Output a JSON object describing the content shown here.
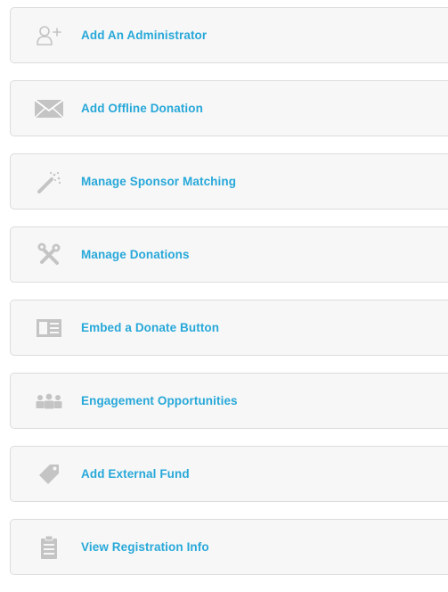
{
  "actions": [
    {
      "label": "Add An Administrator",
      "icon": "add-user-icon"
    },
    {
      "label": "Add Offline Donation",
      "icon": "envelope-icon"
    },
    {
      "label": "Manage Sponsor Matching",
      "icon": "magic-wand-icon"
    },
    {
      "label": "Manage Donations",
      "icon": "tools-icon"
    },
    {
      "label": "Embed a Donate Button",
      "icon": "embed-icon"
    },
    {
      "label": "Engagement Opportunities",
      "icon": "group-icon"
    },
    {
      "label": "Add External Fund",
      "icon": "tag-icon"
    },
    {
      "label": "View Registration Info",
      "icon": "clipboard-icon"
    }
  ],
  "colors": {
    "label": "#27a8d9",
    "icon": "#c4c4c4",
    "card_background": "#f7f7f7",
    "card_border": "#dcdcdc"
  }
}
